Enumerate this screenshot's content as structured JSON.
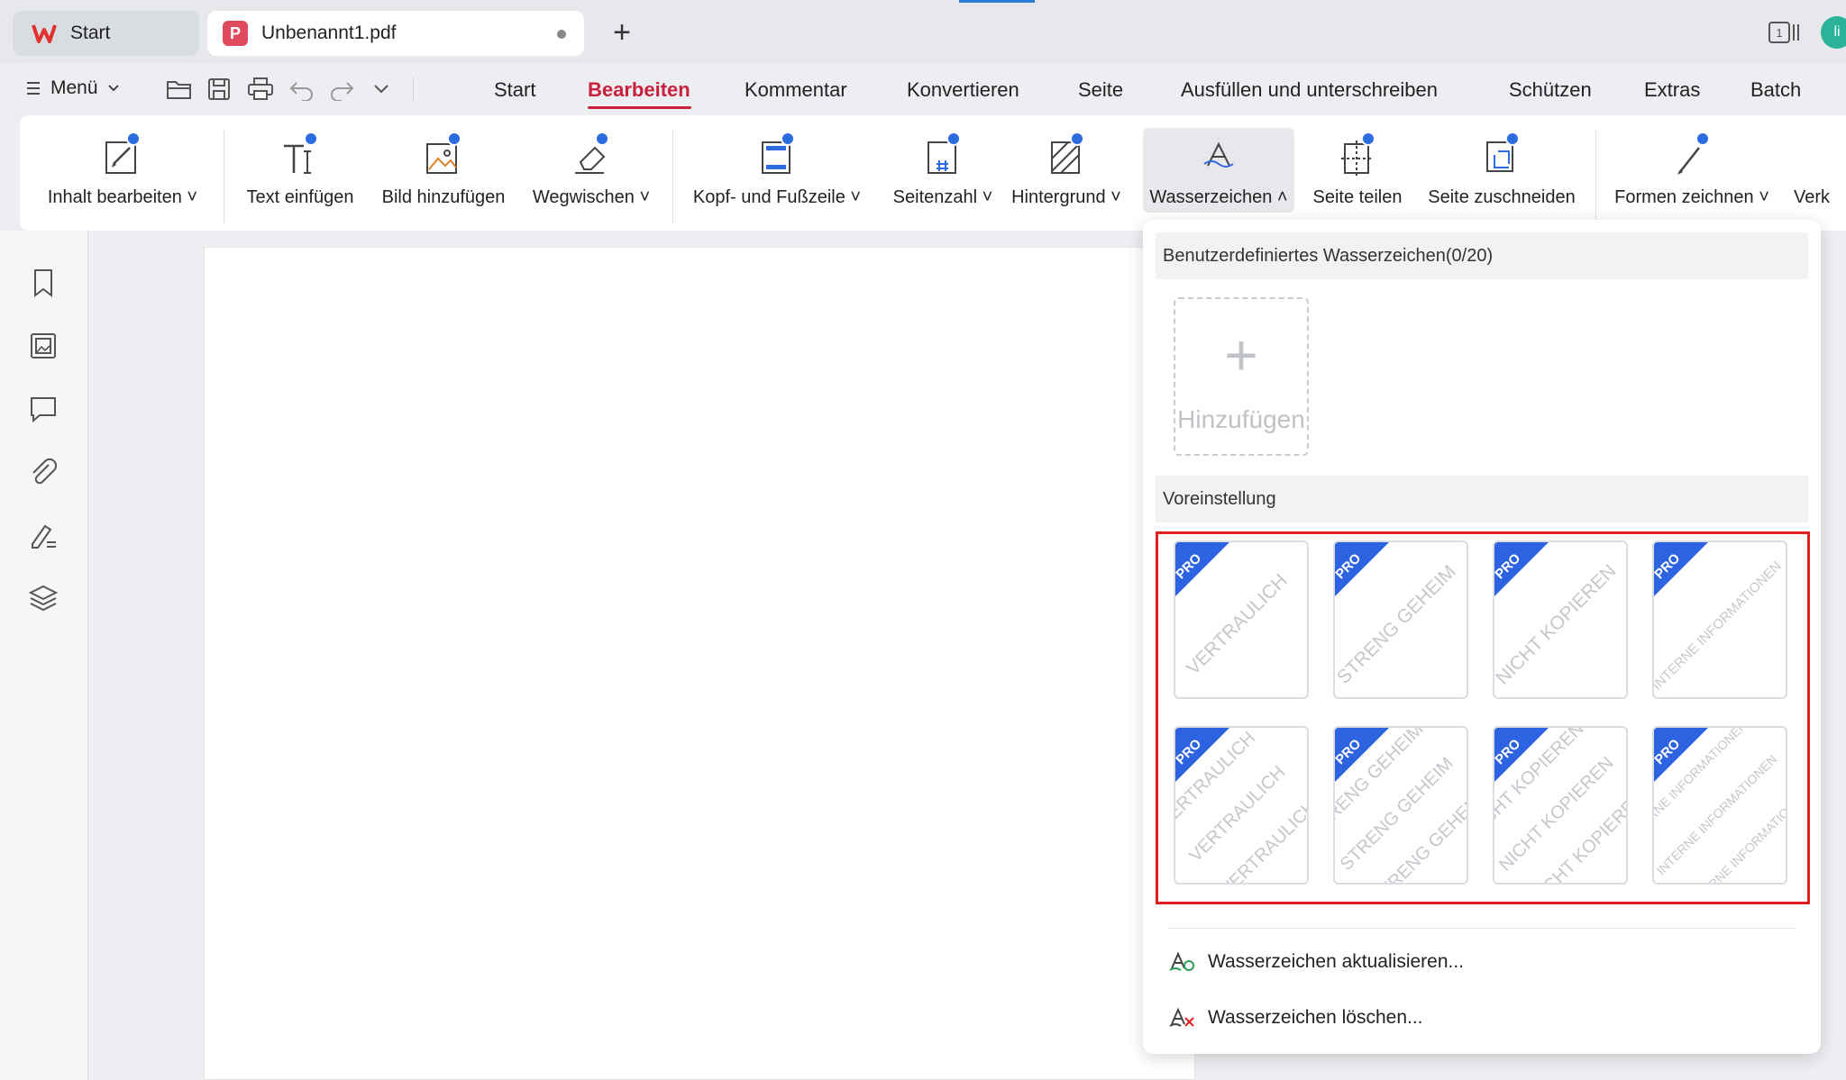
{
  "tabs": [
    {
      "label": "Start"
    },
    {
      "label": "Unbenannt1.pdf"
    }
  ],
  "window": {
    "badge": "1",
    "avatar": "li"
  },
  "menu": {
    "label": "Menü"
  },
  "ribbon_tabs": [
    "Start",
    "Bearbeiten",
    "Kommentar",
    "Konvertieren",
    "Seite",
    "Ausfüllen und unterschreiben",
    "Schützen",
    "Extras",
    "Batch"
  ],
  "active_ribbon_tab": "Bearbeiten",
  "ribbon": {
    "inhalt": "Inhalt bearbeiten",
    "text": "Text einfügen",
    "bild": "Bild hinzufügen",
    "wegwischen": "Wegwischen",
    "kopf": "Kopf- und Fußzeile",
    "seitenzahl": "Seitenzahl",
    "hintergrund": "Hintergrund",
    "wasserzeichen": "Wasserzeichen",
    "teilen": "Seite teilen",
    "zuschneiden": "Seite zuschneiden",
    "formen": "Formen zeichnen",
    "verk": "Verk"
  },
  "dropdown": {
    "custom_header": "Benutzerdefiniertes Wasserzeichen(0/20)",
    "add_label": "Hinzufügen",
    "preset_header": "Voreinstellung",
    "pro_label": "PRO",
    "presets": [
      {
        "text": "VERTRAULICH",
        "style": "single"
      },
      {
        "text": "STRENG GEHEIM",
        "style": "single"
      },
      {
        "text": "NICHT KOPIEREN",
        "style": "single"
      },
      {
        "text": "INTERNE INFORMATIONEN",
        "style": "single"
      },
      {
        "text": "VERTRAULICH",
        "style": "tiled"
      },
      {
        "text": "STRENG GEHEIM",
        "style": "tiled"
      },
      {
        "text": "NICHT KOPIEREN",
        "style": "tiled"
      },
      {
        "text": "INTERNE INFORMATIONEN",
        "style": "tiled"
      }
    ],
    "update_label": "Wasserzeichen aktualisieren...",
    "delete_label": "Wasserzeichen löschen..."
  },
  "colors": {
    "accent": "#c9203b",
    "pro_badge": "#2d63e0",
    "highlight_border": "#e02020"
  }
}
